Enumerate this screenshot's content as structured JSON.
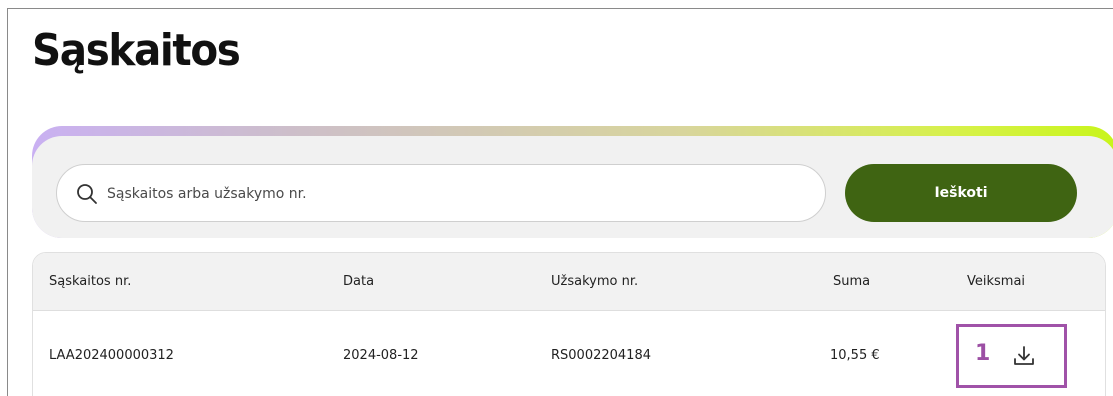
{
  "page": {
    "title": "Sąskaitos"
  },
  "search": {
    "placeholder": "Sąskaitos arba užsakymo nr.",
    "value": "",
    "button_label": "Ieškoti"
  },
  "table": {
    "columns": [
      "Sąskaitos nr.",
      "Data",
      "Užsakymo nr.",
      "Suma",
      "Veiksmai"
    ],
    "rows": [
      {
        "invoice_no": "LAA202400000312",
        "date": "2024-08-12",
        "order_no": "RS0002204184",
        "amount": "10,55 €",
        "action_icon": "download-icon"
      }
    ]
  },
  "annotation": {
    "step": "1",
    "color": "#a052a8"
  },
  "colors": {
    "accent_button": "#3f6412",
    "gradient": [
      "#c9b0f2",
      "#d7f14a"
    ]
  }
}
